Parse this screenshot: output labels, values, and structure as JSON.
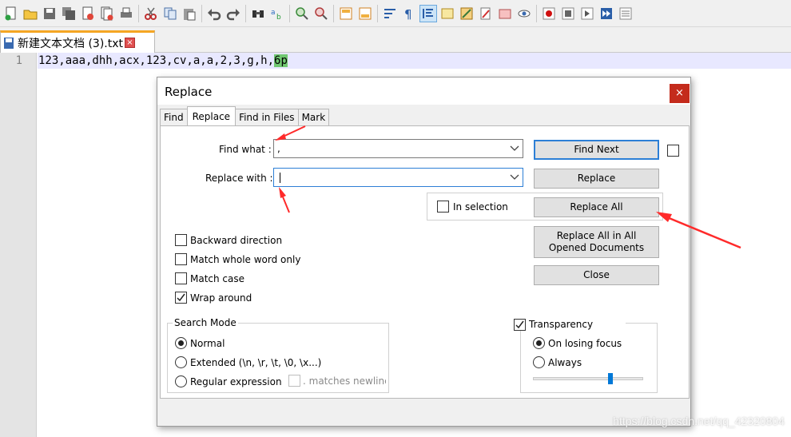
{
  "editor_tab": {
    "filename": "新建文本文档 (3).txt",
    "close_glyph": "×"
  },
  "editor": {
    "line_number": "1",
    "code_before": "123,aaa,dhh,acx,123,cv,a,a,2,3,g,h,",
    "code_highlight": "6p"
  },
  "dialog": {
    "title": "Replace",
    "close_glyph": "×",
    "tabs": [
      {
        "label": "Find",
        "active": false
      },
      {
        "label": "Replace",
        "active": true
      },
      {
        "label": "Find in Files",
        "active": false
      },
      {
        "label": "Mark",
        "active": false
      }
    ],
    "find_what_label": "Find what :",
    "find_what_value": ",",
    "replace_with_label": "Replace with :",
    "replace_with_value": "",
    "buttons": {
      "find_next": "Find Next",
      "replace": "Replace",
      "replace_all": "Replace All",
      "replace_all_opened": "Replace All in All Opened Documents",
      "close": "Close"
    },
    "in_selection": {
      "label": "In selection",
      "checked": false
    },
    "options": [
      {
        "label": "Backward direction",
        "checked": false
      },
      {
        "label": "Match whole word only",
        "checked": false
      },
      {
        "label": "Match case",
        "checked": false
      },
      {
        "label": "Wrap around",
        "checked": true
      }
    ],
    "search_mode": {
      "title": "Search Mode",
      "options": [
        {
          "label": "Normal",
          "selected": true
        },
        {
          "label": "Extended (\\n, \\r, \\t, \\0, \\x...)",
          "selected": false
        },
        {
          "label": "Regular expression",
          "selected": false
        }
      ],
      "matches_newline": ". matches newline"
    },
    "transparency": {
      "label": "Transparency",
      "checked": true,
      "options": [
        {
          "label": "On losing focus",
          "selected": true
        },
        {
          "label": "Always",
          "selected": false
        }
      ],
      "slider_level": 0.7
    }
  },
  "watermark": "https://blog.csdn.net/qq_42320804",
  "colors": {
    "accent": "#2d7fd6",
    "annotation_arrow": "#ff2a2a",
    "tab_marker": "#f5a623"
  }
}
